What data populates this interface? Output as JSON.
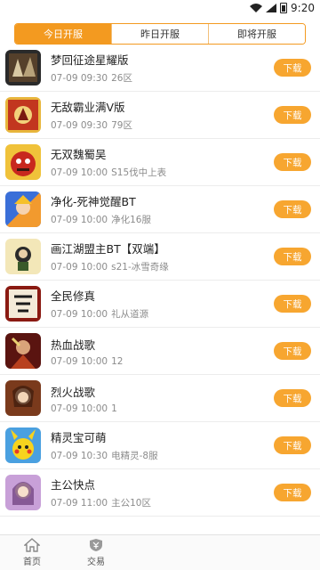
{
  "status": {
    "time": "9:20"
  },
  "tabs": [
    {
      "label": "今日开服",
      "active": true
    },
    {
      "label": "昨日开服",
      "active": false
    },
    {
      "label": "即将开服",
      "active": false
    }
  ],
  "download_label": "下载",
  "items": [
    {
      "name": "梦回征途星耀版",
      "time": "07-09 09:30",
      "server": "26区"
    },
    {
      "name": "无敌霸业满V版",
      "time": "07-09 09:30",
      "server": "79区"
    },
    {
      "name": "无双魏蜀吴",
      "time": "07-09 10:00",
      "server": "S15伐中上表"
    },
    {
      "name": "净化-死神觉醒BT",
      "time": "07-09 10:00",
      "server": "净化16服"
    },
    {
      "name": "画江湖盟主BT【双端】",
      "time": "07-09 10:00",
      "server": "s21-冰雪奇缘"
    },
    {
      "name": "全民修真",
      "time": "07-09 10:00",
      "server": "礼从道源"
    },
    {
      "name": "热血战歌",
      "time": "07-09 10:00",
      "server": "12"
    },
    {
      "name": "烈火战歌",
      "time": "07-09 10:00",
      "server": "1"
    },
    {
      "name": "精灵宝可萌",
      "time": "07-09 10:30",
      "server": "电精灵-8服"
    },
    {
      "name": "主公快点",
      "time": "07-09 11:00",
      "server": "主公10区"
    }
  ],
  "icons": [
    "game-icon-menghui",
    "game-icon-wudi",
    "game-icon-wushuang",
    "game-icon-jinghua",
    "game-icon-huajianghu",
    "game-icon-quanmin",
    "game-icon-rexue",
    "game-icon-liehuo",
    "game-icon-jingling",
    "game-icon-zhugong"
  ],
  "nav": [
    {
      "label": "首页",
      "icon": "home-icon"
    },
    {
      "label": "交易",
      "icon": "trade-shield-icon"
    }
  ],
  "colors": {
    "accent": "#f39a20",
    "download": "#f7a630"
  }
}
